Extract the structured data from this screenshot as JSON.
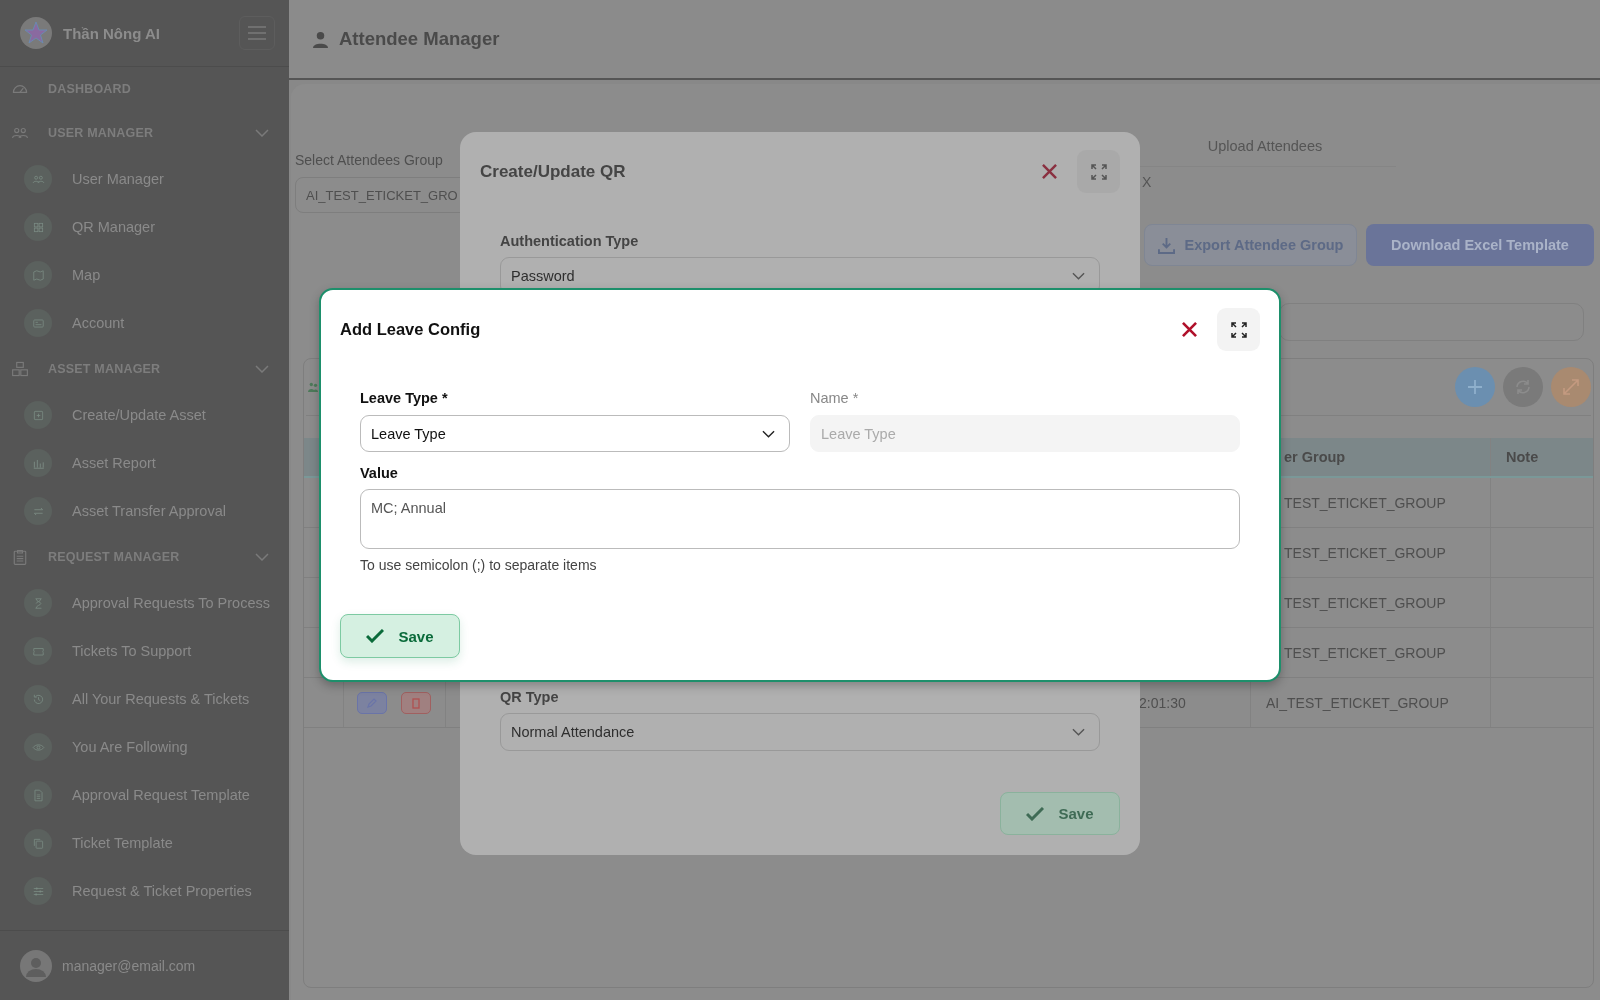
{
  "sidebar": {
    "brand": "Thần Nông AI",
    "sections": [
      {
        "label": "DASHBOARD"
      },
      {
        "label": "USER MANAGER",
        "expanded": true,
        "children": [
          {
            "label": "User Manager"
          },
          {
            "label": "QR Manager"
          },
          {
            "label": "Map"
          },
          {
            "label": "Account"
          }
        ]
      },
      {
        "label": "ASSET MANAGER",
        "expanded": true,
        "children": [
          {
            "label": "Create/Update Asset"
          },
          {
            "label": "Asset Report"
          },
          {
            "label": "Asset Transfer Approval"
          }
        ]
      },
      {
        "label": "REQUEST MANAGER",
        "expanded": true,
        "children": [
          {
            "label": "Approval Requests To Process"
          },
          {
            "label": "Tickets To Support"
          },
          {
            "label": "All Your Requests & Tickets"
          },
          {
            "label": "You Are Following"
          },
          {
            "label": "Approval Request Template"
          },
          {
            "label": "Ticket Template"
          },
          {
            "label": "Request & Ticket Properties"
          }
        ]
      }
    ],
    "user_email": "manager@email.com"
  },
  "header": {
    "title": "Attendee Manager"
  },
  "attendees": {
    "group_label": "Select Attendees Group",
    "group_value": "AI_TEST_ETICKET_GRO",
    "upload_tab": "Upload Attendees",
    "upload_close": "X",
    "export_button": "Export Attendee Group",
    "template_button": "Download Excel Template",
    "table": {
      "columns": [
        "er Group",
        "Note"
      ],
      "rows": [
        {
          "kind": "covered",
          "group": "TEST_ETICKET_GROUP"
        },
        {
          "kind": "covered",
          "group": "TEST_ETICKET_GROUP"
        },
        {
          "kind": "covered",
          "group": "TEST_ETICKET_GROUP"
        },
        {
          "kind": "covered",
          "group": "TEST_ETICKET_GROUP"
        },
        {
          "kind": "full",
          "time": "2:01:30",
          "group": "AI_TEST_ETICKET_GROUP"
        }
      ]
    }
  },
  "qr_modal": {
    "title": "Create/Update QR",
    "fields": [
      {
        "label": "Authentication Type",
        "value": "Password"
      },
      {
        "label": "QR Type",
        "value": "Normal Attendance"
      }
    ],
    "save": "Save"
  },
  "leave_modal": {
    "title": "Add Leave Config",
    "leave_type": {
      "label": "Leave Type *",
      "value": "Leave Type"
    },
    "name": {
      "label": "Name *",
      "disabled": true,
      "placeholder": "Leave Type"
    },
    "value": {
      "label": "Value",
      "placeholder": "MC; Annual"
    },
    "hint": "To use semicolon (;) to separate items",
    "save": "Save"
  }
}
